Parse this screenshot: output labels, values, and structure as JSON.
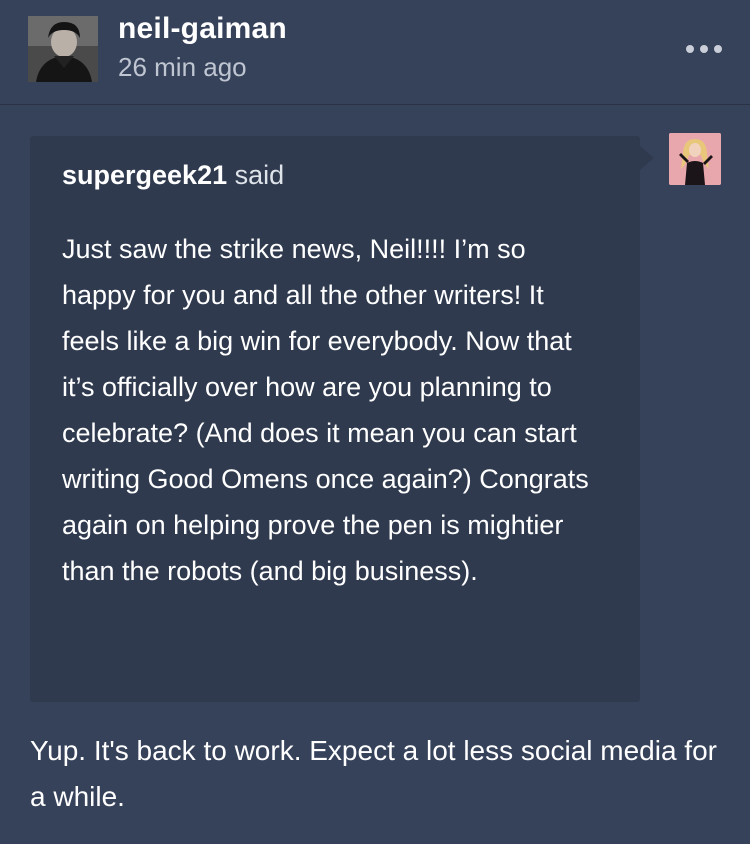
{
  "post": {
    "author": "neil-gaiman",
    "time_ago": "26 min ago",
    "more_icon": "ellipsis-icon"
  },
  "ask": {
    "asker": "supergeek21",
    "said_label": "said",
    "question": "Just saw the strike news, Neil!!!! I’m so happy for you and all the other writers! It feels like a big win for everybody. Now that it’s officially over how are you planning to celebrate? (And does it mean you can start writing Good Omens once again?) Congrats again on helping prove the pen is mightier than the robots (and big business)."
  },
  "answer": {
    "text": "Yup. It's back to work. Expect a lot less social media for a while."
  },
  "colors": {
    "background": "#36425a",
    "quote_background": "#2f3a4f",
    "text": "#ffffff",
    "muted_text": "#bfc6d2"
  }
}
